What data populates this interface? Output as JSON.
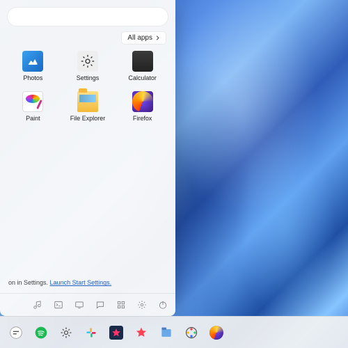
{
  "start": {
    "search_placeholder": "",
    "all_apps_label": "All apps",
    "pinned": [
      {
        "label": "Photos",
        "icon": "photos"
      },
      {
        "label": "Settings",
        "icon": "settings"
      },
      {
        "label": "Calculator",
        "icon": "calculator"
      },
      {
        "label": "Paint",
        "icon": "paint"
      },
      {
        "label": "File Explorer",
        "icon": "file-explorer"
      },
      {
        "label": "Firefox",
        "icon": "firefox"
      }
    ],
    "hint_prefix": "on in Settings. ",
    "hint_link": "Launch Start Settings.",
    "bottom_icons": [
      "music",
      "terminal",
      "display",
      "chat",
      "actions",
      "settings",
      "power"
    ]
  },
  "taskbar": {
    "items": [
      "chat-bubble",
      "spotify",
      "settings",
      "slack",
      "star",
      "favorite",
      "files",
      "color",
      "firefox"
    ]
  }
}
